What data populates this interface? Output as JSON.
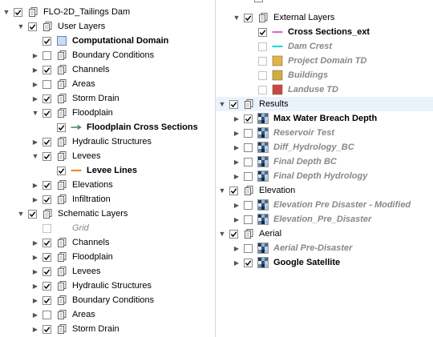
{
  "left_tree": [
    {
      "label": "FLO-2D_Tailings Dam",
      "indent": 0,
      "arrow": "open",
      "checked": true,
      "icon": "group-icon",
      "style": "normal"
    },
    {
      "label": "User Layers",
      "indent": 1,
      "arrow": "open",
      "checked": true,
      "icon": "group-icon",
      "style": "normal"
    },
    {
      "label": "Computational Domain",
      "indent": 2,
      "arrow": "none",
      "checked": true,
      "icon": "polygon-icon",
      "icon_color": "#c9dcf3",
      "style": "bold"
    },
    {
      "label": "Boundary Conditions",
      "indent": 2,
      "arrow": "closed",
      "checked": false,
      "icon": "group-icon",
      "style": "normal"
    },
    {
      "label": "Channels",
      "indent": 2,
      "arrow": "closed",
      "checked": true,
      "icon": "group-icon",
      "style": "normal"
    },
    {
      "label": "Areas",
      "indent": 2,
      "arrow": "closed",
      "checked": false,
      "icon": "group-icon",
      "style": "normal"
    },
    {
      "label": "Storm Drain",
      "indent": 2,
      "arrow": "closed",
      "checked": true,
      "icon": "group-icon",
      "style": "normal"
    },
    {
      "label": "Floodplain",
      "indent": 2,
      "arrow": "open",
      "checked": true,
      "icon": "group-icon",
      "style": "normal"
    },
    {
      "label": "Floodplain Cross Sections",
      "indent": 3,
      "arrow": "none",
      "checked": true,
      "icon": "arrow-line-icon",
      "icon_color": "#3a7a4a",
      "style": "bold"
    },
    {
      "label": "Hydraulic Structures",
      "indent": 2,
      "arrow": "closed",
      "checked": true,
      "icon": "group-icon",
      "style": "normal"
    },
    {
      "label": "Levees",
      "indent": 2,
      "arrow": "open",
      "checked": true,
      "icon": "group-icon",
      "style": "normal"
    },
    {
      "label": "Levee Lines",
      "indent": 3,
      "arrow": "none",
      "checked": true,
      "icon": "line-icon",
      "icon_color": "#f08a24",
      "style": "bold"
    },
    {
      "label": "Elevations",
      "indent": 2,
      "arrow": "closed",
      "checked": true,
      "icon": "group-icon",
      "style": "normal"
    },
    {
      "label": "Infiltration",
      "indent": 2,
      "arrow": "closed",
      "checked": true,
      "icon": "group-icon",
      "style": "normal"
    },
    {
      "label": "Schematic Layers",
      "indent": 1,
      "arrow": "open",
      "checked": true,
      "icon": "group-icon",
      "style": "normal"
    },
    {
      "label": "Grid",
      "indent": 2,
      "arrow": "none",
      "checked": false,
      "disabled_cb": true,
      "icon": "none",
      "style": "disabled-italic"
    },
    {
      "label": "Channels",
      "indent": 2,
      "arrow": "closed",
      "checked": true,
      "icon": "group-icon",
      "style": "normal"
    },
    {
      "label": "Floodplain",
      "indent": 2,
      "arrow": "closed",
      "checked": true,
      "icon": "group-icon",
      "style": "normal"
    },
    {
      "label": "Levees",
      "indent": 2,
      "arrow": "closed",
      "checked": true,
      "icon": "group-icon",
      "style": "normal"
    },
    {
      "label": "Hydraulic Structures",
      "indent": 2,
      "arrow": "closed",
      "checked": true,
      "icon": "group-icon",
      "style": "normal"
    },
    {
      "label": "Boundary Conditions",
      "indent": 2,
      "arrow": "closed",
      "checked": true,
      "icon": "group-icon",
      "style": "normal"
    },
    {
      "label": "Areas",
      "indent": 2,
      "arrow": "closed",
      "checked": false,
      "icon": "group-icon",
      "style": "normal"
    },
    {
      "label": "Storm Drain",
      "indent": 2,
      "arrow": "closed",
      "checked": true,
      "icon": "group-icon",
      "style": "normal"
    }
  ],
  "right_tree": [
    {
      "label": "External Layers",
      "indent": 1,
      "arrow": "open",
      "checked": true,
      "icon": "group-icon",
      "style": "normal"
    },
    {
      "label": "Cross Sections_ext",
      "indent": 2,
      "arrow": "none",
      "checked": true,
      "icon": "line-icon",
      "icon_color": "#d070c8",
      "style": "bold"
    },
    {
      "label": "Dam Crest",
      "indent": 2,
      "arrow": "none",
      "checked": false,
      "disabled_cb": true,
      "icon": "line-icon",
      "icon_color": "#2ad8d8",
      "style": "emph"
    },
    {
      "label": "Project Domain TD",
      "indent": 2,
      "arrow": "none",
      "checked": false,
      "disabled_cb": true,
      "icon": "fill-icon",
      "icon_color": "#e3b44a",
      "style": "emph"
    },
    {
      "label": "Buildings",
      "indent": 2,
      "arrow": "none",
      "checked": false,
      "disabled_cb": true,
      "icon": "fill-icon",
      "icon_color": "#cfae40",
      "style": "emph"
    },
    {
      "label": "Landuse TD",
      "indent": 2,
      "arrow": "none",
      "checked": false,
      "disabled_cb": true,
      "icon": "fill-icon",
      "icon_color": "#c84646",
      "style": "emph"
    },
    {
      "label": "Results",
      "indent": 0,
      "arrow": "open",
      "checked": true,
      "icon": "group-icon",
      "style": "normal",
      "highlight": true
    },
    {
      "label": "Max Water Breach Depth",
      "indent": 1,
      "arrow": "closed",
      "checked": true,
      "icon": "raster-icon",
      "style": "bold"
    },
    {
      "label": "Reservoir Test",
      "indent": 1,
      "arrow": "closed",
      "checked": false,
      "icon": "raster-icon",
      "style": "emph"
    },
    {
      "label": "Diff_Hydrology_BC",
      "indent": 1,
      "arrow": "closed",
      "checked": false,
      "icon": "raster-icon",
      "style": "emph"
    },
    {
      "label": "Final Depth BC",
      "indent": 1,
      "arrow": "closed",
      "checked": false,
      "icon": "raster-icon",
      "style": "emph"
    },
    {
      "label": "Final Depth Hydrology",
      "indent": 1,
      "arrow": "closed",
      "checked": false,
      "icon": "raster-icon",
      "style": "emph"
    },
    {
      "label": "Elevation",
      "indent": 0,
      "arrow": "open",
      "checked": true,
      "icon": "group-icon",
      "style": "normal"
    },
    {
      "label": "Elevation Pre Disaster - Modified",
      "indent": 1,
      "arrow": "closed",
      "checked": false,
      "icon": "raster-icon",
      "style": "emph"
    },
    {
      "label": "Elevation_Pre_Disaster",
      "indent": 1,
      "arrow": "closed",
      "checked": false,
      "icon": "raster-icon",
      "style": "emph"
    },
    {
      "label": "Aerial",
      "indent": 0,
      "arrow": "open",
      "checked": true,
      "icon": "group-icon",
      "style": "normal"
    },
    {
      "label": "Aerial Pre-Disaster",
      "indent": 1,
      "arrow": "closed",
      "checked": false,
      "icon": "raster-icon",
      "style": "emph"
    },
    {
      "label": "Google Satellite",
      "indent": 1,
      "arrow": "closed",
      "checked": true,
      "icon": "raster-icon",
      "style": "bold"
    }
  ],
  "colors": {
    "selection_highlight": "#eaf2fb",
    "checkbox_border": "#8a8a8a",
    "disabled_text": "#888888"
  }
}
